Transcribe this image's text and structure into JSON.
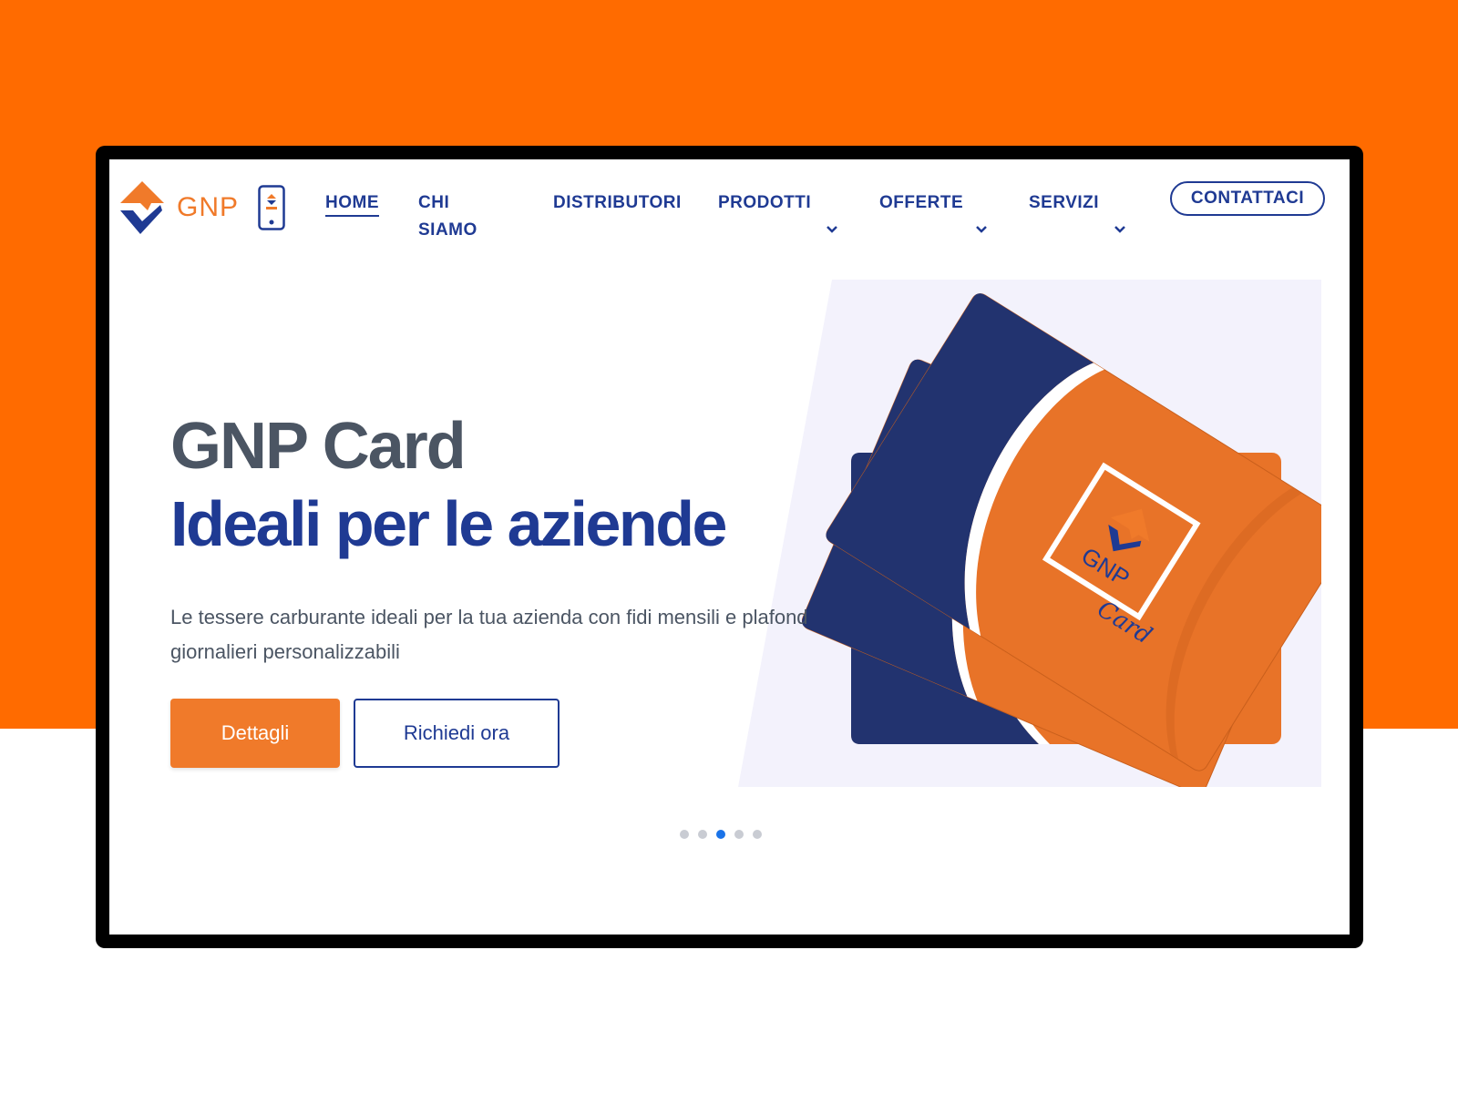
{
  "brand": {
    "name": "GNP",
    "card_logo_text": "GNP",
    "card_script": "Card",
    "colors": {
      "orange": "#f07a2a",
      "navy": "#1f3a93",
      "background_orange": "#ff6b00",
      "grey_text": "#4b5563"
    }
  },
  "nav": {
    "home": "HOME",
    "about_line1": "CHI",
    "about_line2": "SIAMO",
    "distributors": "DISTRIBUTORI",
    "products": "PRODOTTI",
    "offers": "OFFERTE",
    "services": "SERVIZI",
    "contact": "CONTATTACI"
  },
  "hero": {
    "title_line1": "GNP Card",
    "title_line2": "Ideali per le aziende",
    "description": "Le tessere carburante ideali per la tua azienda con fidi mensili e plafond giornalieri personalizzabili",
    "primary_button": "Dettagli",
    "secondary_button": "Richiedi ora"
  },
  "carousel": {
    "total_slides": 5,
    "active_slide": 3
  },
  "icons": [
    "gnp-logo-icon",
    "mobile-app-icon",
    "chevron-down-icon",
    "gnp-card-image"
  ]
}
